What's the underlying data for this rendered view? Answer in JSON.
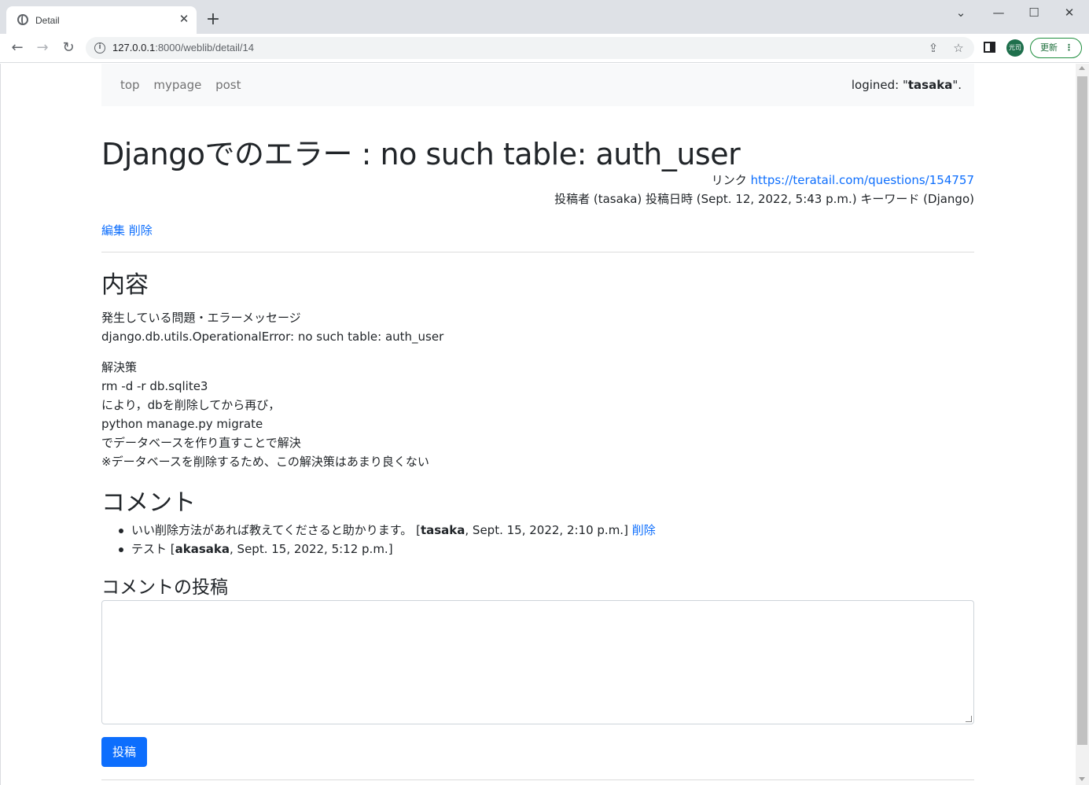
{
  "browser": {
    "tab_title": "Detail",
    "tab_close": "✕",
    "new_tab": "+",
    "url_host": "127.0.0.1",
    "url_path": ":8000/weblib/detail/14",
    "avatar_text": "光司",
    "update_label": "更新",
    "window_controls": {
      "dropdown": "⌄",
      "minimize": "—",
      "maximize": "☐",
      "close": "✕"
    }
  },
  "nav": {
    "links": [
      "top",
      "mypage",
      "post"
    ],
    "logined_prefix": "logined: \"",
    "logined_user": "tasaka",
    "logined_suffix": "\"."
  },
  "post": {
    "title": "Djangoでのエラー : no such table: auth_user",
    "link_label": "リンク",
    "link_url": "https://teratail.com/questions/154757",
    "meta": "投稿者 (tasaka) 投稿日時 (Sept. 12, 2022, 5:43 p.m.) キーワード (Django)",
    "edit_label": "編集",
    "delete_label": "削除"
  },
  "content": {
    "heading": "内容",
    "para1": [
      "発生している問題・エラーメッセージ",
      "django.db.utils.OperationalError: no such table: auth_user"
    ],
    "para2": [
      "解決策",
      "rm -d -r db.sqlite3",
      "により，dbを削除してから再び，",
      "python manage.py migrate",
      "でデータベースを作り直すことで解決",
      "※データベースを削除するため、この解決策はあまり良くない"
    ]
  },
  "comments": {
    "heading": "コメント",
    "items": [
      {
        "text": "いい削除方法があれば教えてくださると助かります。",
        "author": "tasaka",
        "date": ", Sept. 15, 2022, 2:10 p.m.]",
        "delete": "削除"
      },
      {
        "text": "テスト",
        "author": "akasaka",
        "date": ", Sept. 15, 2022, 5:12 p.m.]",
        "delete": ""
      }
    ]
  },
  "form": {
    "heading": "コメントの投稿",
    "submit_label": "投稿"
  }
}
